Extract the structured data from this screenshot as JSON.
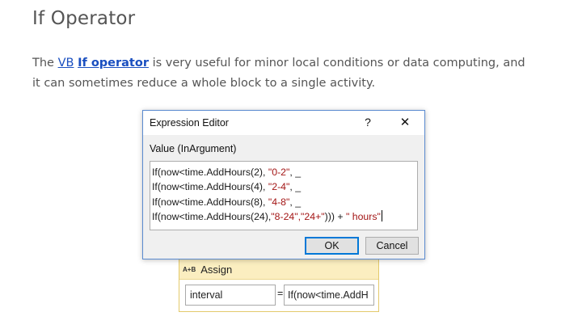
{
  "article": {
    "title": "If Operator",
    "para_prefix": "The ",
    "link_vb": "VB",
    "link_if": "If operator",
    "para_rest": " is very useful for minor local conditions or data computing, and it can sometimes reduce a whole block to a single activity."
  },
  "dialog": {
    "title": "Expression Editor",
    "help": "?",
    "close": "✕",
    "value_label": "Value (InArgument)",
    "code": [
      {
        "pre": "If(now<time.AddHours(2), ",
        "str": "\"0-2\"",
        "post": ", _"
      },
      {
        "pre": "If(now<time.AddHours(4), ",
        "str": "\"2-4\"",
        "post": ", _"
      },
      {
        "pre": "If(now<time.AddHours(8), ",
        "str": "\"4-8\"",
        "post": ", _"
      },
      {
        "pre": "If(now<time.AddHours(24),",
        "str": "\"8-24\",\"24+\"",
        "post": "))) +",
        "str2": "\" hours\""
      }
    ],
    "ok_label": "OK",
    "cancel_label": "Cancel"
  },
  "assign": {
    "icon": "A+B",
    "label": "Assign",
    "to_value": "interval",
    "eq": "=",
    "expr_value": "If(now<time.AddH"
  }
}
